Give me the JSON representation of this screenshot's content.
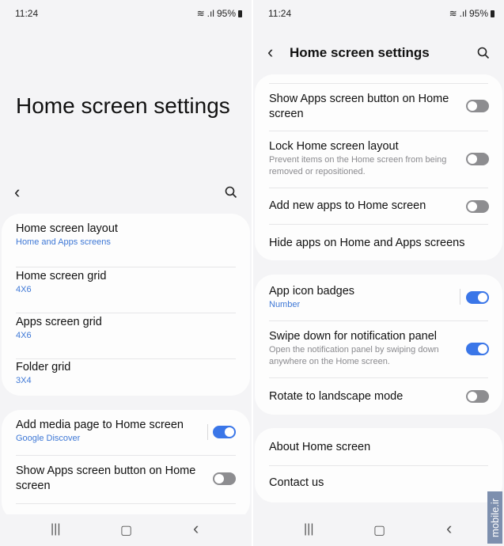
{
  "status": {
    "time": "11:24",
    "battery": "95%"
  },
  "left": {
    "title": "Home screen settings",
    "card1": [
      {
        "title": "Home screen layout",
        "sub": "Home and Apps screens"
      },
      {
        "title": "Home screen grid",
        "sub": "4X6"
      },
      {
        "title": "Apps screen grid",
        "sub": "4X6"
      },
      {
        "title": "Folder grid",
        "sub": "3X4"
      }
    ],
    "card2": [
      {
        "title": "Add media page to Home screen",
        "sub": "Google Discover",
        "on": true
      },
      {
        "title": "Show Apps screen button on Home screen",
        "on": false
      }
    ]
  },
  "right": {
    "title": "Home screen settings",
    "card1": [
      {
        "title": "Show Apps screen button on Home screen",
        "on": false
      },
      {
        "title": "Lock Home screen layout",
        "desc": "Prevent items on the Home screen from being removed or repositioned.",
        "on": false
      },
      {
        "title": "Add new apps to Home screen",
        "on": false
      },
      {
        "title": "Hide apps on Home and Apps screens"
      }
    ],
    "card2": [
      {
        "title": "App icon badges",
        "sub": "Number",
        "on": true
      },
      {
        "title": "Swipe down for notification panel",
        "desc": "Open the notification panel by swiping down anywhere on the Home screen.",
        "on": true
      },
      {
        "title": "Rotate to landscape mode",
        "on": false
      }
    ],
    "card3": [
      {
        "title": "About Home screen"
      },
      {
        "title": "Contact us"
      }
    ]
  },
  "nav": {
    "recents": "|||",
    "home": "▢",
    "back": "‹"
  },
  "watermark": "mobile.ir",
  "colors": {
    "accent": "#3a76e8",
    "link": "#3e78d6",
    "background": "#f4f4f6"
  }
}
